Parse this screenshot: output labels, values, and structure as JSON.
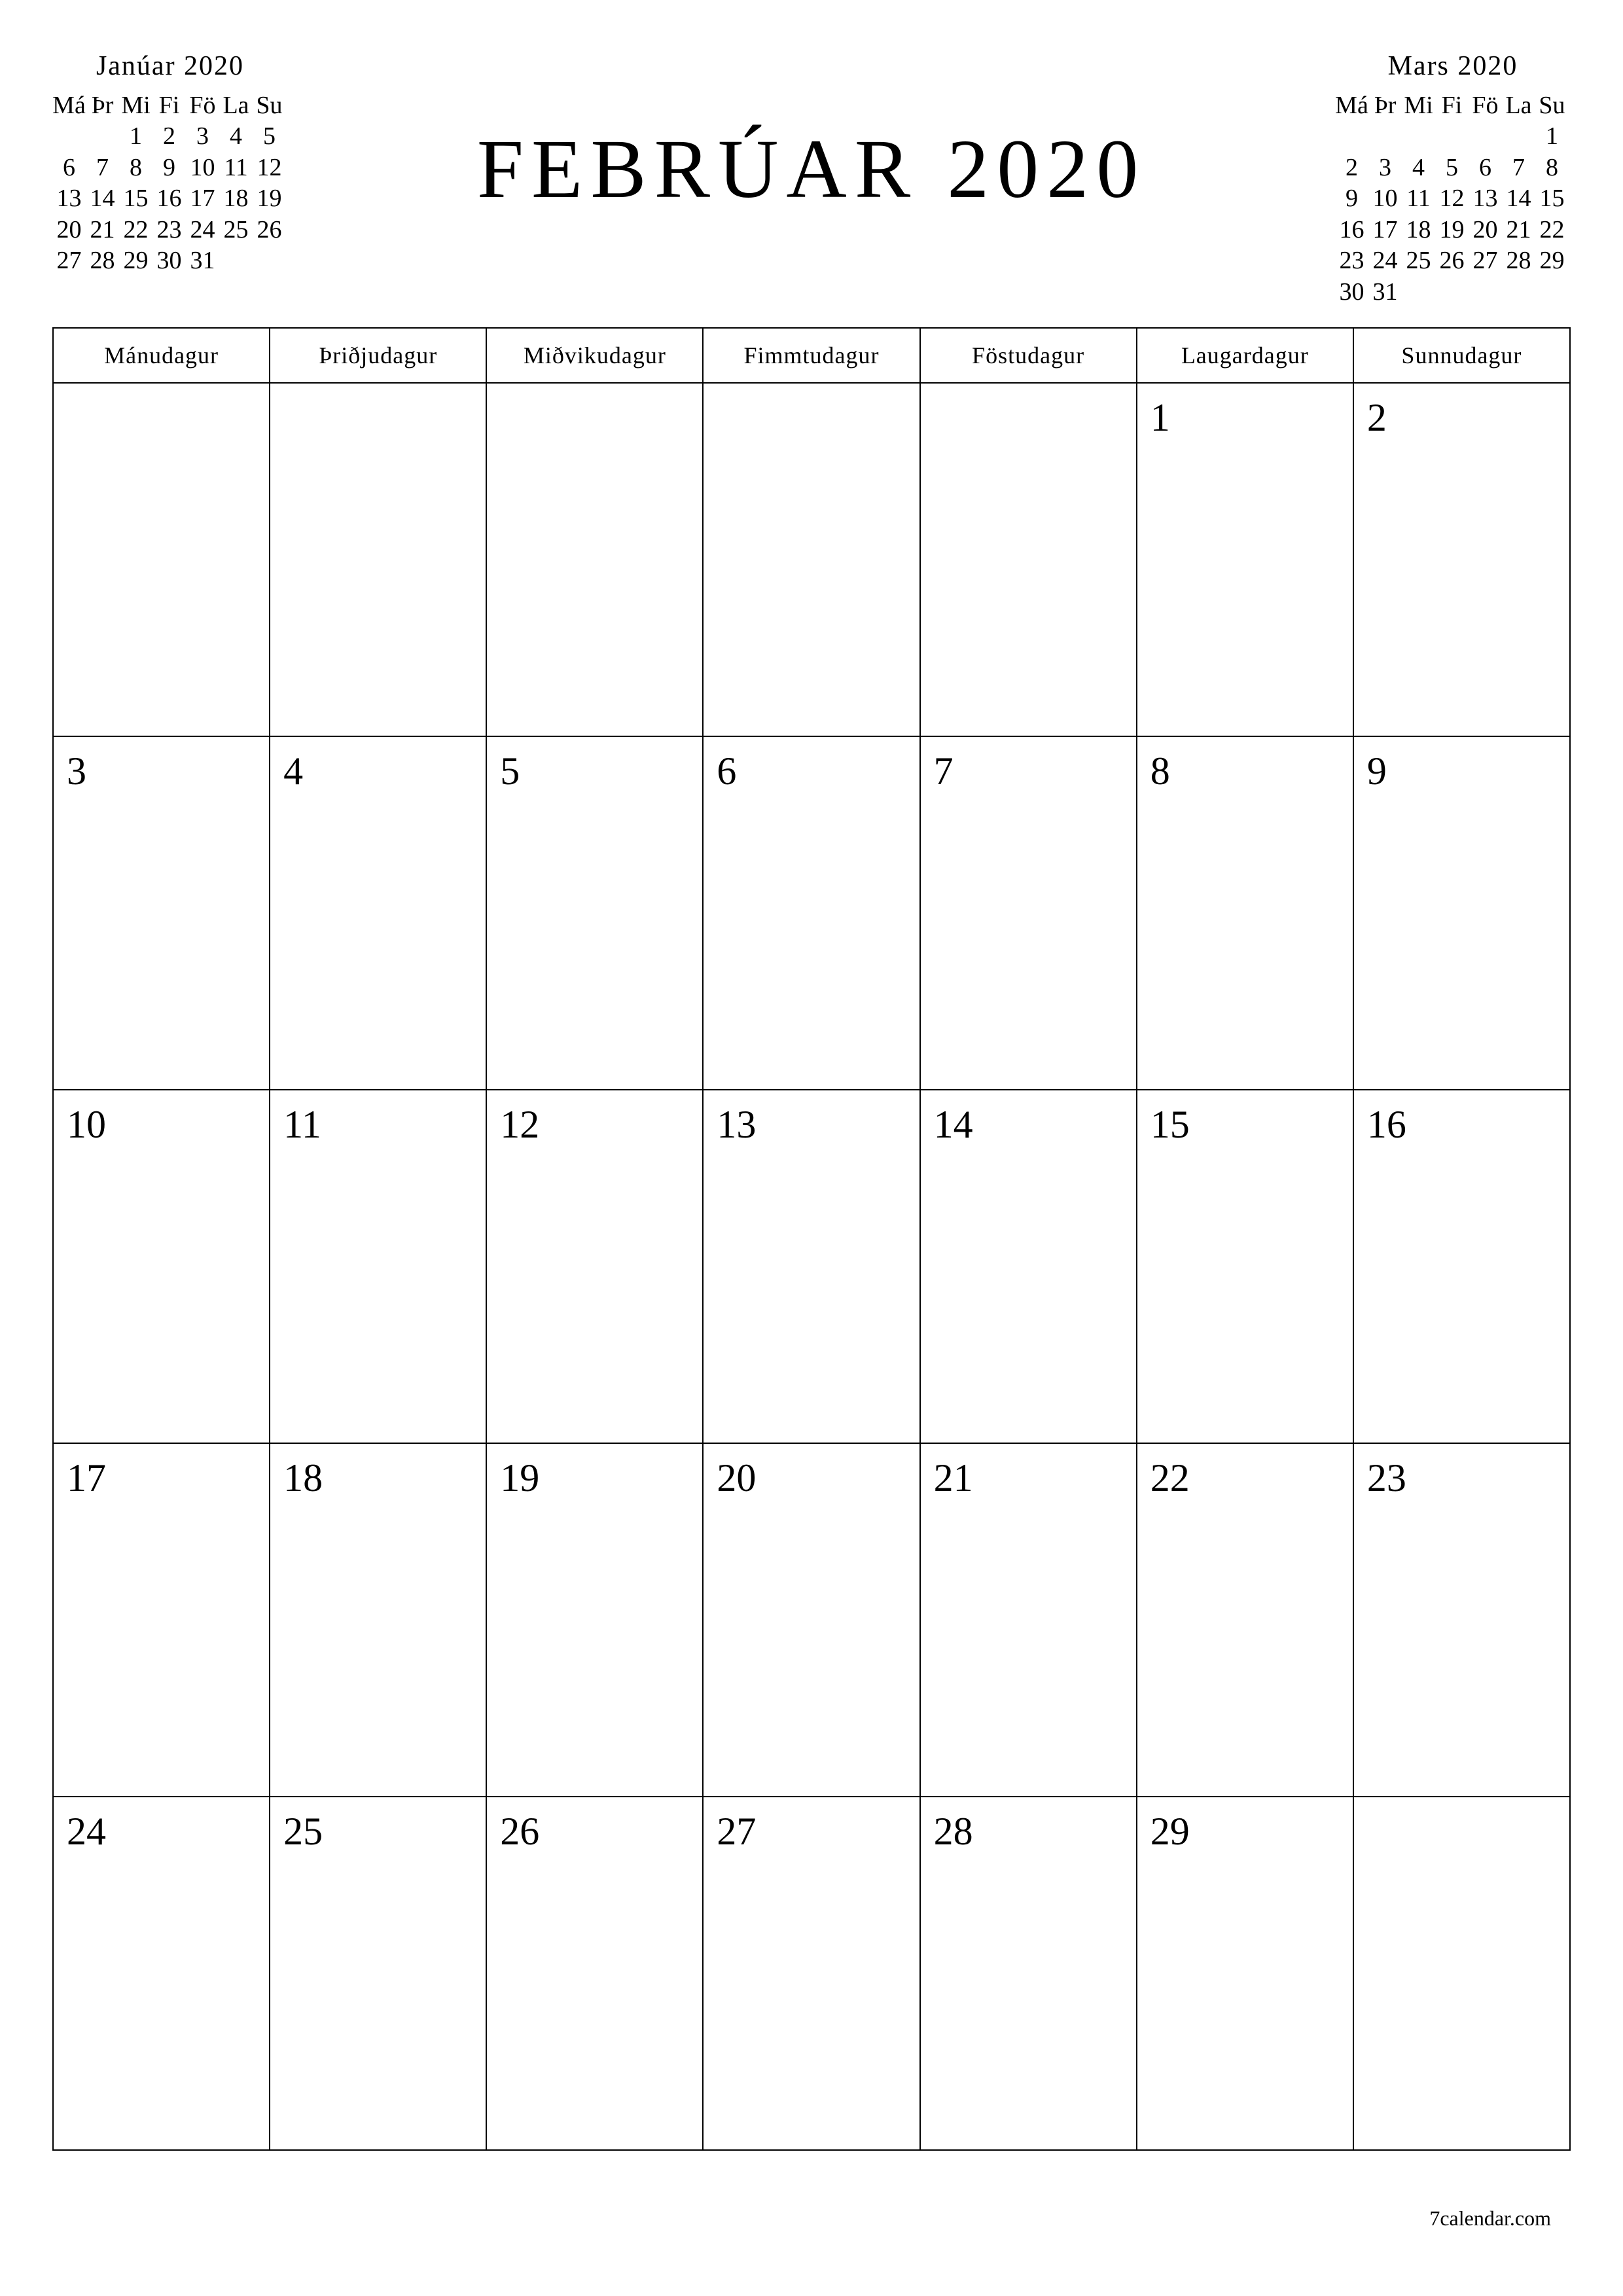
{
  "title": "FEBRÚAR 2020",
  "weekdays_long": [
    "Mánudagur",
    "Þriðjudagur",
    "Miðvikudagur",
    "Fimmtudagur",
    "Föstudagur",
    "Laugardagur",
    "Sunnudagur"
  ],
  "weekdays_short": [
    "Má",
    "Þr",
    "Mi",
    "Fi",
    "Fö",
    "La",
    "Su"
  ],
  "main_grid": [
    [
      "",
      "",
      "",
      "",
      "",
      "1",
      "2"
    ],
    [
      "3",
      "4",
      "5",
      "6",
      "7",
      "8",
      "9"
    ],
    [
      "10",
      "11",
      "12",
      "13",
      "14",
      "15",
      "16"
    ],
    [
      "17",
      "18",
      "19",
      "20",
      "21",
      "22",
      "23"
    ],
    [
      "24",
      "25",
      "26",
      "27",
      "28",
      "29",
      ""
    ]
  ],
  "prev_month": {
    "title": "Janúar 2020",
    "rows": [
      [
        "",
        "",
        "1",
        "2",
        "3",
        "4",
        "5"
      ],
      [
        "6",
        "7",
        "8",
        "9",
        "10",
        "11",
        "12"
      ],
      [
        "13",
        "14",
        "15",
        "16",
        "17",
        "18",
        "19"
      ],
      [
        "20",
        "21",
        "22",
        "23",
        "24",
        "25",
        "26"
      ],
      [
        "27",
        "28",
        "29",
        "30",
        "31",
        "",
        ""
      ]
    ]
  },
  "next_month": {
    "title": "Mars 2020",
    "rows": [
      [
        "",
        "",
        "",
        "",
        "",
        "",
        "1"
      ],
      [
        "2",
        "3",
        "4",
        "5",
        "6",
        "7",
        "8"
      ],
      [
        "9",
        "10",
        "11",
        "12",
        "13",
        "14",
        "15"
      ],
      [
        "16",
        "17",
        "18",
        "19",
        "20",
        "21",
        "22"
      ],
      [
        "23",
        "24",
        "25",
        "26",
        "27",
        "28",
        "29"
      ],
      [
        "30",
        "31",
        "",
        "",
        "",
        "",
        ""
      ]
    ]
  },
  "footer": "7calendar.com"
}
